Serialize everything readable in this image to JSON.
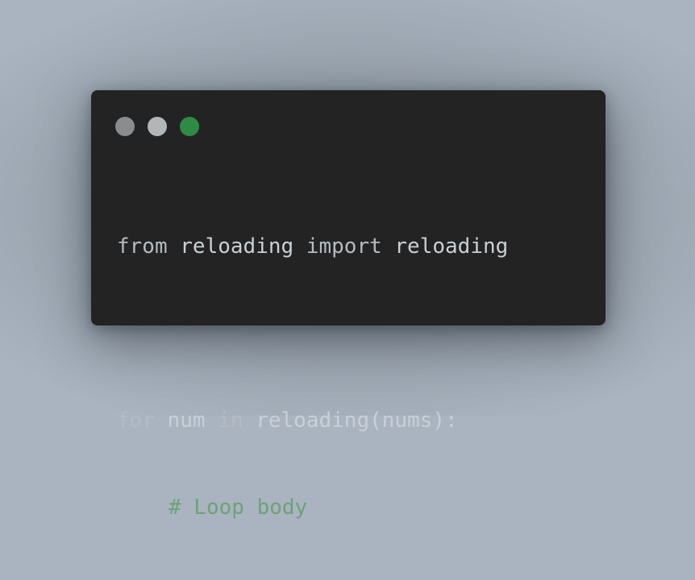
{
  "window": {
    "dots": [
      {
        "name": "close",
        "color": "#8a8d90"
      },
      {
        "name": "minimize",
        "color": "#b3b6b9"
      },
      {
        "name": "maximize",
        "color": "#2f8a45"
      }
    ]
  },
  "code": {
    "line1": {
      "kw_from": "from",
      "module": "reloading",
      "kw_import": "import",
      "name": "reloading"
    },
    "line3": {
      "kw_for": "for",
      "var": "num",
      "kw_in": "in",
      "call": "reloading(nums):"
    },
    "line4": {
      "comment": "# Loop body"
    }
  },
  "colors": {
    "background": "#a9b4c0",
    "window": "#232323",
    "keyword": "#b4bcc2",
    "identifier": "#c8d0d6",
    "comment": "#6fa178"
  }
}
